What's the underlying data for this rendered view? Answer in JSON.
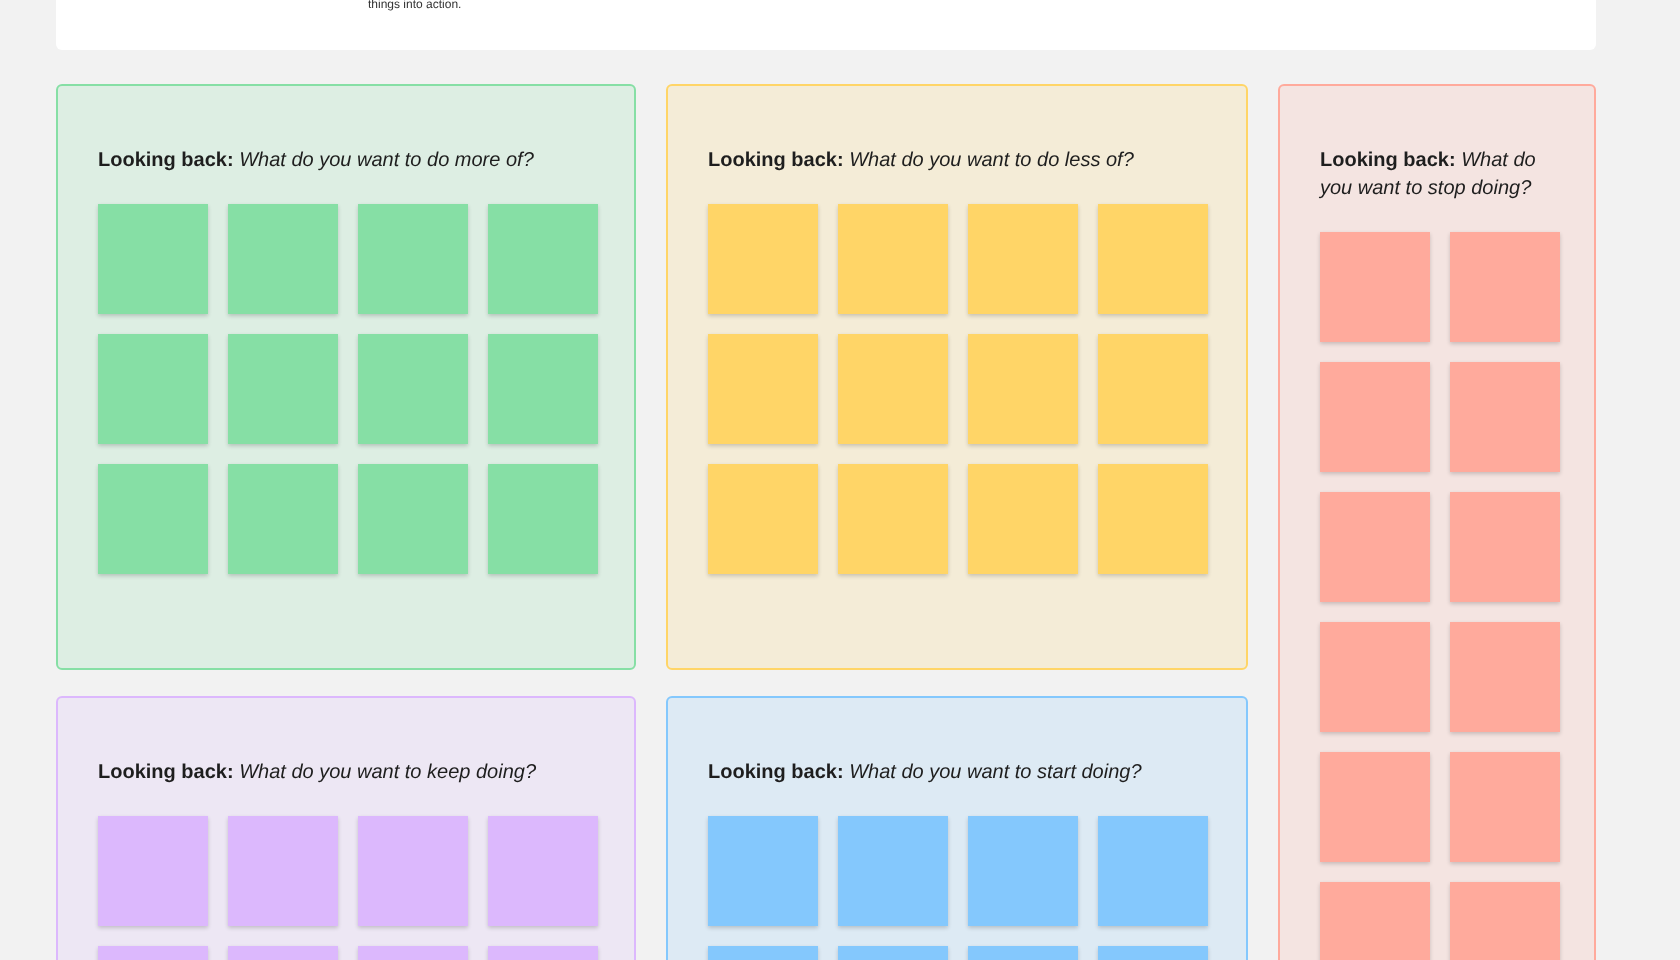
{
  "top_card": {
    "text": "things into action."
  },
  "columns": [
    {
      "panels": [
        {
          "title": "**Looking back:** *What do you want to do more of?*",
          "color": "#86dfa5",
          "notes": [
            {
              "color": "#86dfa5"
            },
            {
              "color": "#86dfa5"
            },
            {
              "color": "#86dfa5"
            },
            {
              "color": "#86dfa5"
            },
            {
              "color": "#86dfa5"
            },
            {
              "color": "#86dfa5"
            },
            {
              "color": "#86dfa5"
            },
            {
              "color": "#86dfa5"
            },
            {
              "color": "#86dfa5"
            },
            {
              "color": "#86dfa5"
            },
            {
              "color": "#86dfa5"
            },
            {
              "color": "#86dfa5"
            }
          ]
        },
        {
          "title": "**Looking back:** *What do you want to keep doing?*",
          "color": "#dcb8fd",
          "notes": [
            {
              "color": "#dcb8fd"
            },
            {
              "color": "#dcb8fd"
            },
            {
              "color": "#dcb8fd"
            },
            {
              "color": "#dcb8fd"
            },
            {
              "color": "#dcb8fd"
            },
            {
              "color": "#dcb8fd"
            },
            {
              "color": "#dcb8fd"
            },
            {
              "color": "#dcb8fd"
            }
          ]
        }
      ]
    },
    {
      "panels": [
        {
          "title": "**Looking back:** *What do you want to do less of?*",
          "color": "#ffd567",
          "notes": [
            {
              "color": "#ffd567"
            },
            {
              "color": "#ffd567"
            },
            {
              "color": "#ffd567"
            },
            {
              "color": "#ffd567"
            },
            {
              "color": "#ffd567"
            },
            {
              "color": "#ffd567"
            },
            {
              "color": "#ffd567"
            },
            {
              "color": "#ffd567"
            },
            {
              "color": "#ffd567"
            },
            {
              "color": "#ffd567"
            },
            {
              "color": "#ffd567"
            },
            {
              "color": "#ffd567"
            }
          ]
        },
        {
          "title": "**Looking back:** *What do you want to start doing?*",
          "color": "#84c8fd",
          "notes": [
            {
              "color": "#84c8fd"
            },
            {
              "color": "#84c8fd"
            },
            {
              "color": "#84c8fd"
            },
            {
              "color": "#84c8fd"
            },
            {
              "color": "#84c8fd"
            },
            {
              "color": "#84c8fd"
            },
            {
              "color": "#84c8fd"
            },
            {
              "color": "#84c8fd"
            }
          ]
        }
      ]
    },
    {
      "panels": [
        {
          "title": "**Looking back:** *What do you want to stop doing?*",
          "color": "#ffaa9c",
          "notes": [
            {
              "color": "#ffaa9c"
            },
            {
              "color": "#ffaa9c"
            },
            {
              "color": "#ffaa9c"
            },
            {
              "color": "#ffaa9c"
            },
            {
              "color": "#ffaa9c"
            },
            {
              "color": "#ffaa9c"
            },
            {
              "color": "#ffaa9c"
            },
            {
              "color": "#ffaa9c"
            },
            {
              "color": "#ffaa9c"
            },
            {
              "color": "#ffaa9c"
            },
            {
              "color": "#ffaa9c"
            },
            {
              "color": "#ffaa9c"
            }
          ]
        }
      ]
    }
  ]
}
